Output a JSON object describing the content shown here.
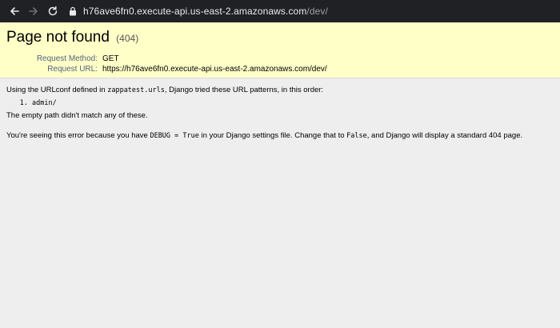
{
  "browser": {
    "url_host": "h76ave6fn0.execute-api.us-east-2.amazonaws.com",
    "url_path": "/dev/"
  },
  "summary": {
    "title": "Page not found",
    "code": "(404)",
    "request_method_label": "Request Method:",
    "request_method_value": "GET",
    "request_url_label": "Request URL:",
    "request_url_value": "https://h76ave6fn0.execute-api.us-east-2.amazonaws.com/dev/"
  },
  "info": {
    "urlconf_prefix": "Using the URLconf defined in ",
    "urlconf_module": "zappatest.urls",
    "urlconf_suffix": ", Django tried these URL patterns, in this order:",
    "patterns": [
      "admin/"
    ],
    "no_match": "The empty path didn't match any of these.",
    "debug_prefix": "You're seeing this error because you have ",
    "debug_code": "DEBUG = True",
    "debug_middle": " in your Django settings file. Change that to ",
    "debug_false": "False",
    "debug_suffix": ", and Django will display a standard 404 page."
  }
}
